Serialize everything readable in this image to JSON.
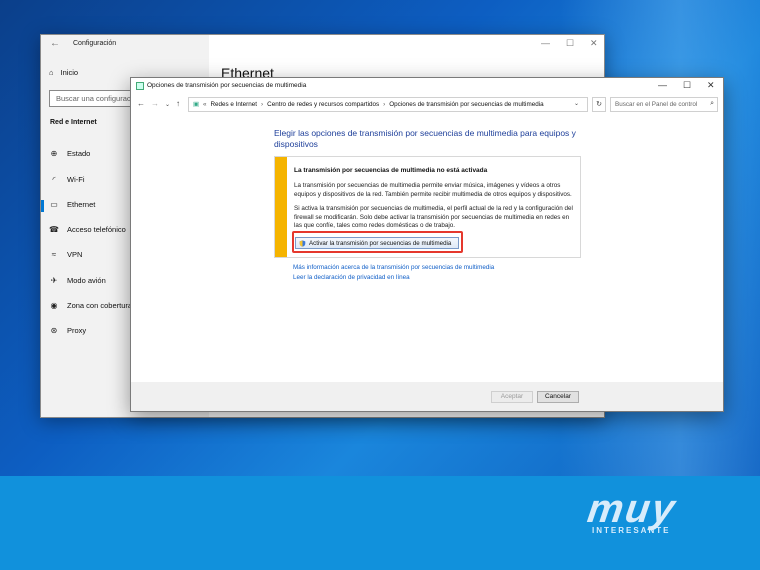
{
  "settings": {
    "title": "Configuración",
    "home": "Inicio",
    "search_placeholder": "Buscar una configuración",
    "section": "Red e Internet",
    "heading": "Ethernet",
    "nav": [
      {
        "label": "Estado",
        "icon": "status-icon"
      },
      {
        "label": "Wi-Fi",
        "icon": "wifi-icon"
      },
      {
        "label": "Ethernet",
        "icon": "ethernet-icon",
        "active": true
      },
      {
        "label": "Acceso telefónico",
        "icon": "dialup-icon"
      },
      {
        "label": "VPN",
        "icon": "vpn-icon"
      },
      {
        "label": "Modo avión",
        "icon": "airplane-icon"
      },
      {
        "label": "Zona con cobertura",
        "icon": "hotspot-icon"
      },
      {
        "label": "Proxy",
        "icon": "proxy-icon"
      }
    ]
  },
  "dialog": {
    "title": "Opciones de transmisión por secuencias de multimedia",
    "breadcrumb": [
      "Redes e Internet",
      "Centro de redes y recursos compartidos",
      "Opciones de transmisión por secuencias de multimedia"
    ],
    "search_placeholder": "Buscar en el Panel de control",
    "heading": "Elegir las opciones de transmisión por secuencias de multimedia para equipos y dispositivos",
    "warning_title": "La transmisión por secuencias de multimedia no está activada",
    "warning_p1": "La transmisión por secuencias de multimedia permite enviar música, imágenes y vídeos a otros equipos y dispositivos de la red. También permite recibir multimedia de otros equipos y dispositivos.",
    "warning_p2": "Si activa la transmisión por secuencias de multimedia, el perfil actual de la red y la configuración del firewall se modificarán. Solo debe activar la transmisión por secuencias de multimedia en redes en las que confíe, tales como redes domésticas o de trabajo.",
    "enable_button": "Activar la transmisión por secuencias de multimedia",
    "link_more": "Más información acerca de la transmisión por secuencias de multimedia",
    "link_privacy": "Leer la declaración de privacidad en línea",
    "accept_button": "Aceptar",
    "cancel_button": "Cancelar"
  },
  "watermark": {
    "logo": "muy",
    "sub": "INTERESANTE"
  },
  "colors": {
    "accent": "#0078d4",
    "warning_stripe": "#f5b400",
    "highlight": "#e5382d",
    "link": "#0f5ec7",
    "heading": "#1e3f9a"
  }
}
